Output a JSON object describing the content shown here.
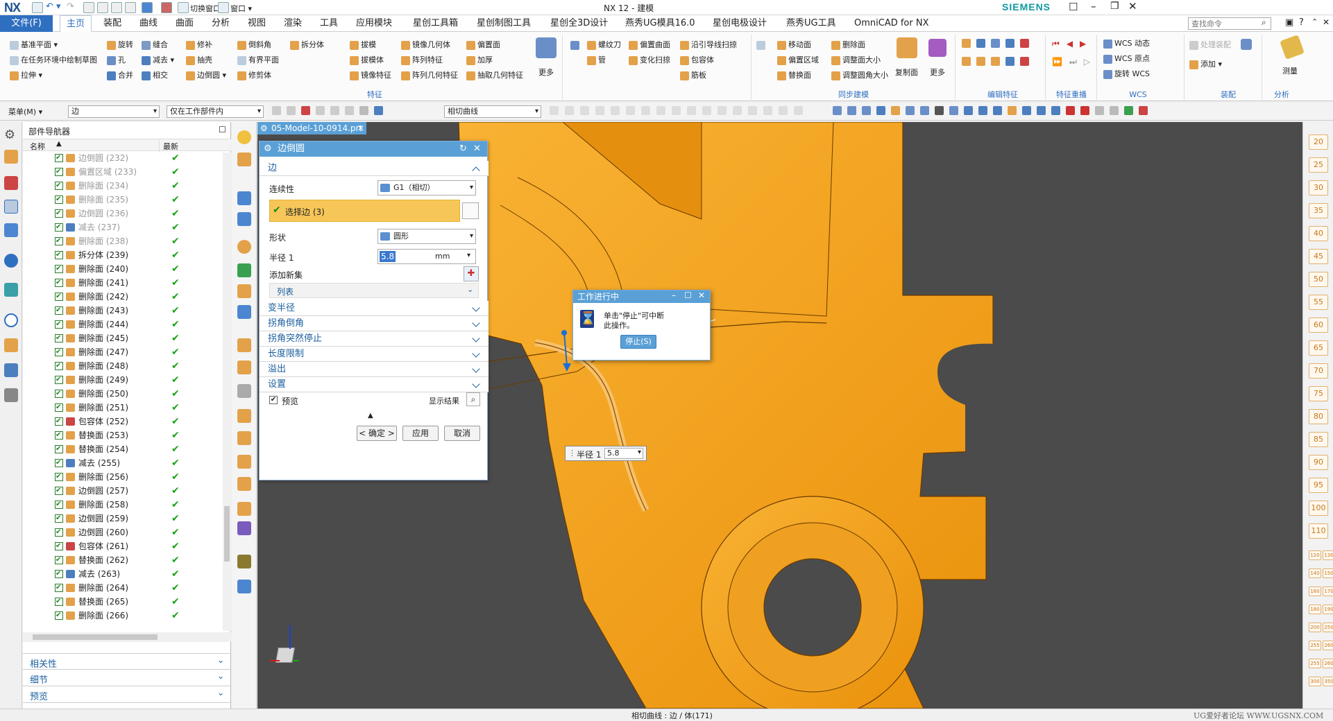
{
  "app": {
    "logo": "NX",
    "window_title": "NX 12 - 建模",
    "brand": "SIEMENS"
  },
  "titlebar": {
    "switch_window": "切换窗口",
    "window_menu": "窗口 ▾"
  },
  "search": {
    "placeholder": "查找命令"
  },
  "tabs": [
    {
      "label": "文件(F)"
    },
    {
      "label": "主页"
    },
    {
      "label": "装配"
    },
    {
      "label": "曲线"
    },
    {
      "label": "曲面"
    },
    {
      "label": "分析"
    },
    {
      "label": "视图"
    },
    {
      "label": "渲染"
    },
    {
      "label": "工具"
    },
    {
      "label": "应用模块"
    },
    {
      "label": "星创工具箱"
    },
    {
      "label": "星创制图工具"
    },
    {
      "label": "星创全3D设计"
    },
    {
      "label": "燕秀UG模具16.0"
    },
    {
      "label": "星创电极设计"
    },
    {
      "label": "燕秀UG工具"
    },
    {
      "label": "OmniCAD for NX"
    }
  ],
  "ribbon": {
    "col1": [
      "基准平面 ▾",
      "在任务环境中绘制草图",
      "拉伸 ▾"
    ],
    "col2": [
      "旋转",
      "孔",
      "合并"
    ],
    "col3": [
      "缝合",
      "减去 ▾",
      "相交"
    ],
    "col4": [
      "修补",
      "抽壳",
      "边倒圆 ▾"
    ],
    "col5": [
      "倒斜角",
      "有界平面",
      "修剪体"
    ],
    "col6": [
      "拆分体"
    ],
    "col7": [
      "拔模",
      "拔模体",
      "镜像特征"
    ],
    "col8": [
      "镜像几何体",
      "阵列特征",
      "阵列几何特征"
    ],
    "col9": [
      "偏置面",
      "加厚",
      "抽取几何特征"
    ],
    "more1": "更多",
    "col10": [
      "螺纹刀",
      "管"
    ],
    "col11": [
      "偏置曲面",
      "变化扫掠"
    ],
    "col12": [
      "沿引导线扫掠",
      "包容体",
      "筋板"
    ],
    "col13": [
      "移动面",
      "偏置区域",
      "替换面"
    ],
    "col14": [
      "删除面",
      "调整面大小",
      "调整圆角大小"
    ],
    "copy_face": "复制面",
    "more2": "更多",
    "wcs": [
      "WCS 动态",
      "WCS 原点",
      "旋转 WCS"
    ],
    "asm": [
      "处理装配",
      "添加 ▾"
    ],
    "measure": "测量",
    "groups": {
      "feature": "特征",
      "sync": "同步建模",
      "edit_feature": "编辑特征",
      "feature_reuse": "特征重播",
      "wcs": "WCS",
      "assembly": "装配",
      "analysis": "分析"
    }
  },
  "selbar": {
    "menu": "菜单(M) ▾",
    "filter": "边",
    "scope": "仅在工作部件内",
    "curve_rule": "相切曲线"
  },
  "navigator": {
    "title": "部件导航器",
    "col_name": "名称",
    "col_latest": "最新",
    "rows": [
      {
        "label": "边倒圆 (232)",
        "grey": true
      },
      {
        "label": "偏置区域 (233)",
        "grey": true
      },
      {
        "label": "删除面 (234)",
        "grey": true
      },
      {
        "label": "删除面 (235)",
        "grey": true
      },
      {
        "label": "边倒圆 (236)",
        "grey": true
      },
      {
        "label": "减去 (237)",
        "grey": true
      },
      {
        "label": "删除面 (238)",
        "grey": true
      },
      {
        "label": "拆分体 (239)",
        "grey": false
      },
      {
        "label": "删除面 (240)",
        "grey": false
      },
      {
        "label": "删除面 (241)",
        "grey": false
      },
      {
        "label": "删除面 (242)",
        "grey": false
      },
      {
        "label": "删除面 (243)",
        "grey": false
      },
      {
        "label": "删除面 (244)",
        "grey": false
      },
      {
        "label": "删除面 (245)",
        "grey": false
      },
      {
        "label": "删除面 (247)",
        "grey": false
      },
      {
        "label": "删除面 (248)",
        "grey": false
      },
      {
        "label": "删除面 (249)",
        "grey": false
      },
      {
        "label": "删除面 (250)",
        "grey": false
      },
      {
        "label": "删除面 (251)",
        "grey": false
      },
      {
        "label": "包容体 (252)",
        "grey": false
      },
      {
        "label": "替换面 (253)",
        "grey": false
      },
      {
        "label": "替换面 (254)",
        "grey": false
      },
      {
        "label": "减去 (255)",
        "grey": false
      },
      {
        "label": "删除面 (256)",
        "grey": false
      },
      {
        "label": "边倒圆 (257)",
        "grey": false
      },
      {
        "label": "删除面 (258)",
        "grey": false
      },
      {
        "label": "边倒圆 (259)",
        "grey": false
      },
      {
        "label": "边倒圆 (260)",
        "grey": false
      },
      {
        "label": "包容体 (261)",
        "grey": false
      },
      {
        "label": "替换面 (262)",
        "grey": false
      },
      {
        "label": "减去 (263)",
        "grey": false
      },
      {
        "label": "删除面 (264)",
        "grey": false
      },
      {
        "label": "替换面 (265)",
        "grey": false
      },
      {
        "label": "删除面 (266)",
        "grey": false
      }
    ],
    "sections": [
      "相关性",
      "细节",
      "预览"
    ]
  },
  "file_tab": {
    "name": "05-Model-10-0914.prt"
  },
  "dialog": {
    "title": "边倒圆",
    "sect_edge": "边",
    "continuity_label": "连续性",
    "continuity_value": "G1（相切）",
    "select_edge": "选择边 (3)",
    "shape_label": "形状",
    "shape_value": "圆形",
    "radius_label": "半径 1",
    "radius_value": "5.8",
    "radius_unit": "mm",
    "add_new_set": "添加新集",
    "list": "列表",
    "sections": [
      "变半径",
      "拐角倒角",
      "拐角突然停止",
      "长度限制",
      "溢出",
      "设置"
    ],
    "preview": "预览",
    "show_result": "显示结果",
    "ok": "< 确定 >",
    "apply": "应用",
    "cancel": "取消"
  },
  "progress": {
    "title": "工作进行中",
    "message_line1": "单击\"停止\"可中断",
    "message_line2": "此操作。",
    "stop": "停止(S)"
  },
  "radius_tag": {
    "label": "半径 1",
    "value": "5.8"
  },
  "right_strip": [
    "20",
    "25",
    "30",
    "35",
    "40",
    "45",
    "50",
    "55",
    "60",
    "65",
    "70",
    "75",
    "80",
    "85",
    "90",
    "95",
    "100",
    "110"
  ],
  "right_strip_small": [
    "120",
    "130",
    "140",
    "150",
    "160",
    "170",
    "180",
    "190",
    "200",
    "250",
    "255",
    "260",
    "255",
    "260",
    "300",
    "350"
  ],
  "status": {
    "text": "相切曲线 : 边 / 体(171)",
    "watermark": "UG爱好者论坛  WWW.UGSNX.COM"
  },
  "colors": {
    "accent": "#2f6fc0",
    "part": "#f5a01a",
    "viewport": "#4b4b4b",
    "dialog_header": "#5aa0d6"
  }
}
